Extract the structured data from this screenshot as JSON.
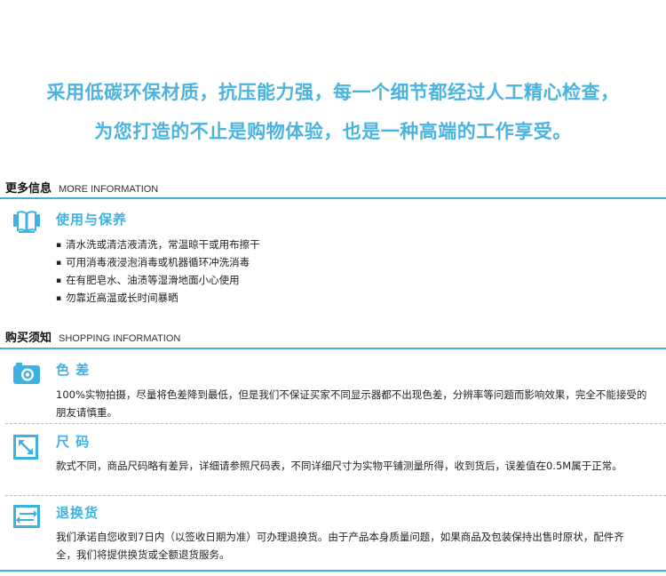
{
  "tagline": {
    "line1": "采用低碳环保材质，抗压能力强，每一个细节都经过人工精心检查，",
    "line2": "为您打造的不止是购物体验，也是一种高端的工作享受。"
  },
  "more_info": {
    "cn": "更多信息",
    "en": "MORE INFORMATION",
    "usage": {
      "icon": "book-icon",
      "title": "使用与保养",
      "items": [
        "清水洗或清洁液清洗，常温晾干或用布擦干",
        "可用消毒液浸泡消毒或机器循环冲洗消毒",
        "在有肥皂水、油渍等湿滑地面小心使用",
        "勿靠近高温或长时间暴晒"
      ]
    }
  },
  "shopping_info": {
    "cn": "购买须知",
    "en": "SHOPPING INFORMATION",
    "color": {
      "icon": "camera-icon",
      "title": "色 差",
      "text": "100%实物拍摄，尽量将色差降到最低，但是我们不保证买家不同显示器都不出现色差，分辨率等问题而影响效果，完全不能接受的朋友请慎重。"
    },
    "size": {
      "icon": "resize-icon",
      "title": "尺 码",
      "text": "款式不同，商品尺码略有差异，详细请参照尺码表，不同详细尺寸为实物平铺测量所得，收到货后，误差值在0.5M属于正常。"
    },
    "returns": {
      "icon": "exchange-icon",
      "title": "退换货",
      "text": "我们承诺自您收到7日内（以签收日期为准）可办理退换货。由于产品本身质量问题，如果商品及包装保持出售时原状，配件齐全，我们将提供换货或全额退货服务。"
    }
  },
  "colors": {
    "accent": "#3fb1e0",
    "tagline": "#4ab3df"
  }
}
